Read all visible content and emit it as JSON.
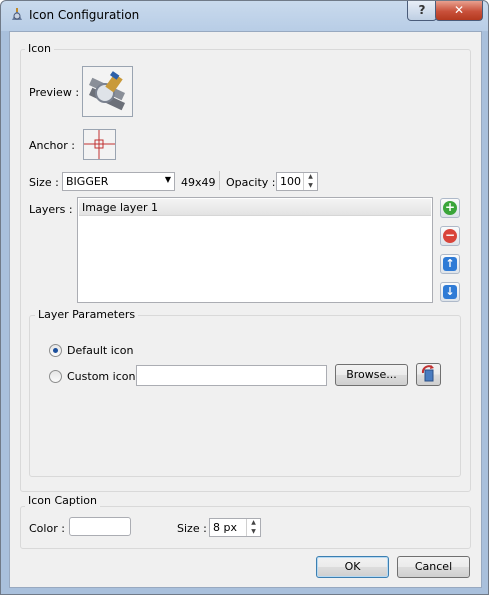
{
  "window": {
    "title": "Icon Configuration",
    "help_label": "?",
    "close_label": "✕"
  },
  "icon_group": {
    "title": "Icon",
    "preview_label": "Preview :",
    "anchor_label": "Anchor :",
    "size_label": "Size :",
    "size_value": "BIGGER",
    "size_dims": "49x49",
    "opacity_label": "Opacity :",
    "opacity_value": "100",
    "layers_label": "Layers :",
    "layers": [
      "Image layer 1"
    ],
    "layer_buttons": [
      "add-icon",
      "remove-icon",
      "arrow-up-icon",
      "arrow-down-icon"
    ]
  },
  "layer_params": {
    "title": "Layer Parameters",
    "default_label": "Default icon",
    "custom_label": "Custom icon",
    "selected": "default",
    "custom_path": "",
    "browse_label": "Browse..."
  },
  "caption": {
    "title": "Icon Caption",
    "color_label": "Color :",
    "size_label": "Size :",
    "size_value": "8 px"
  },
  "buttons": {
    "ok": "OK",
    "cancel": "Cancel"
  },
  "colors": {
    "accent": "#1b4f9c",
    "add": "#3aa53a",
    "remove": "#d9443a",
    "move": "#2f7bd6"
  }
}
